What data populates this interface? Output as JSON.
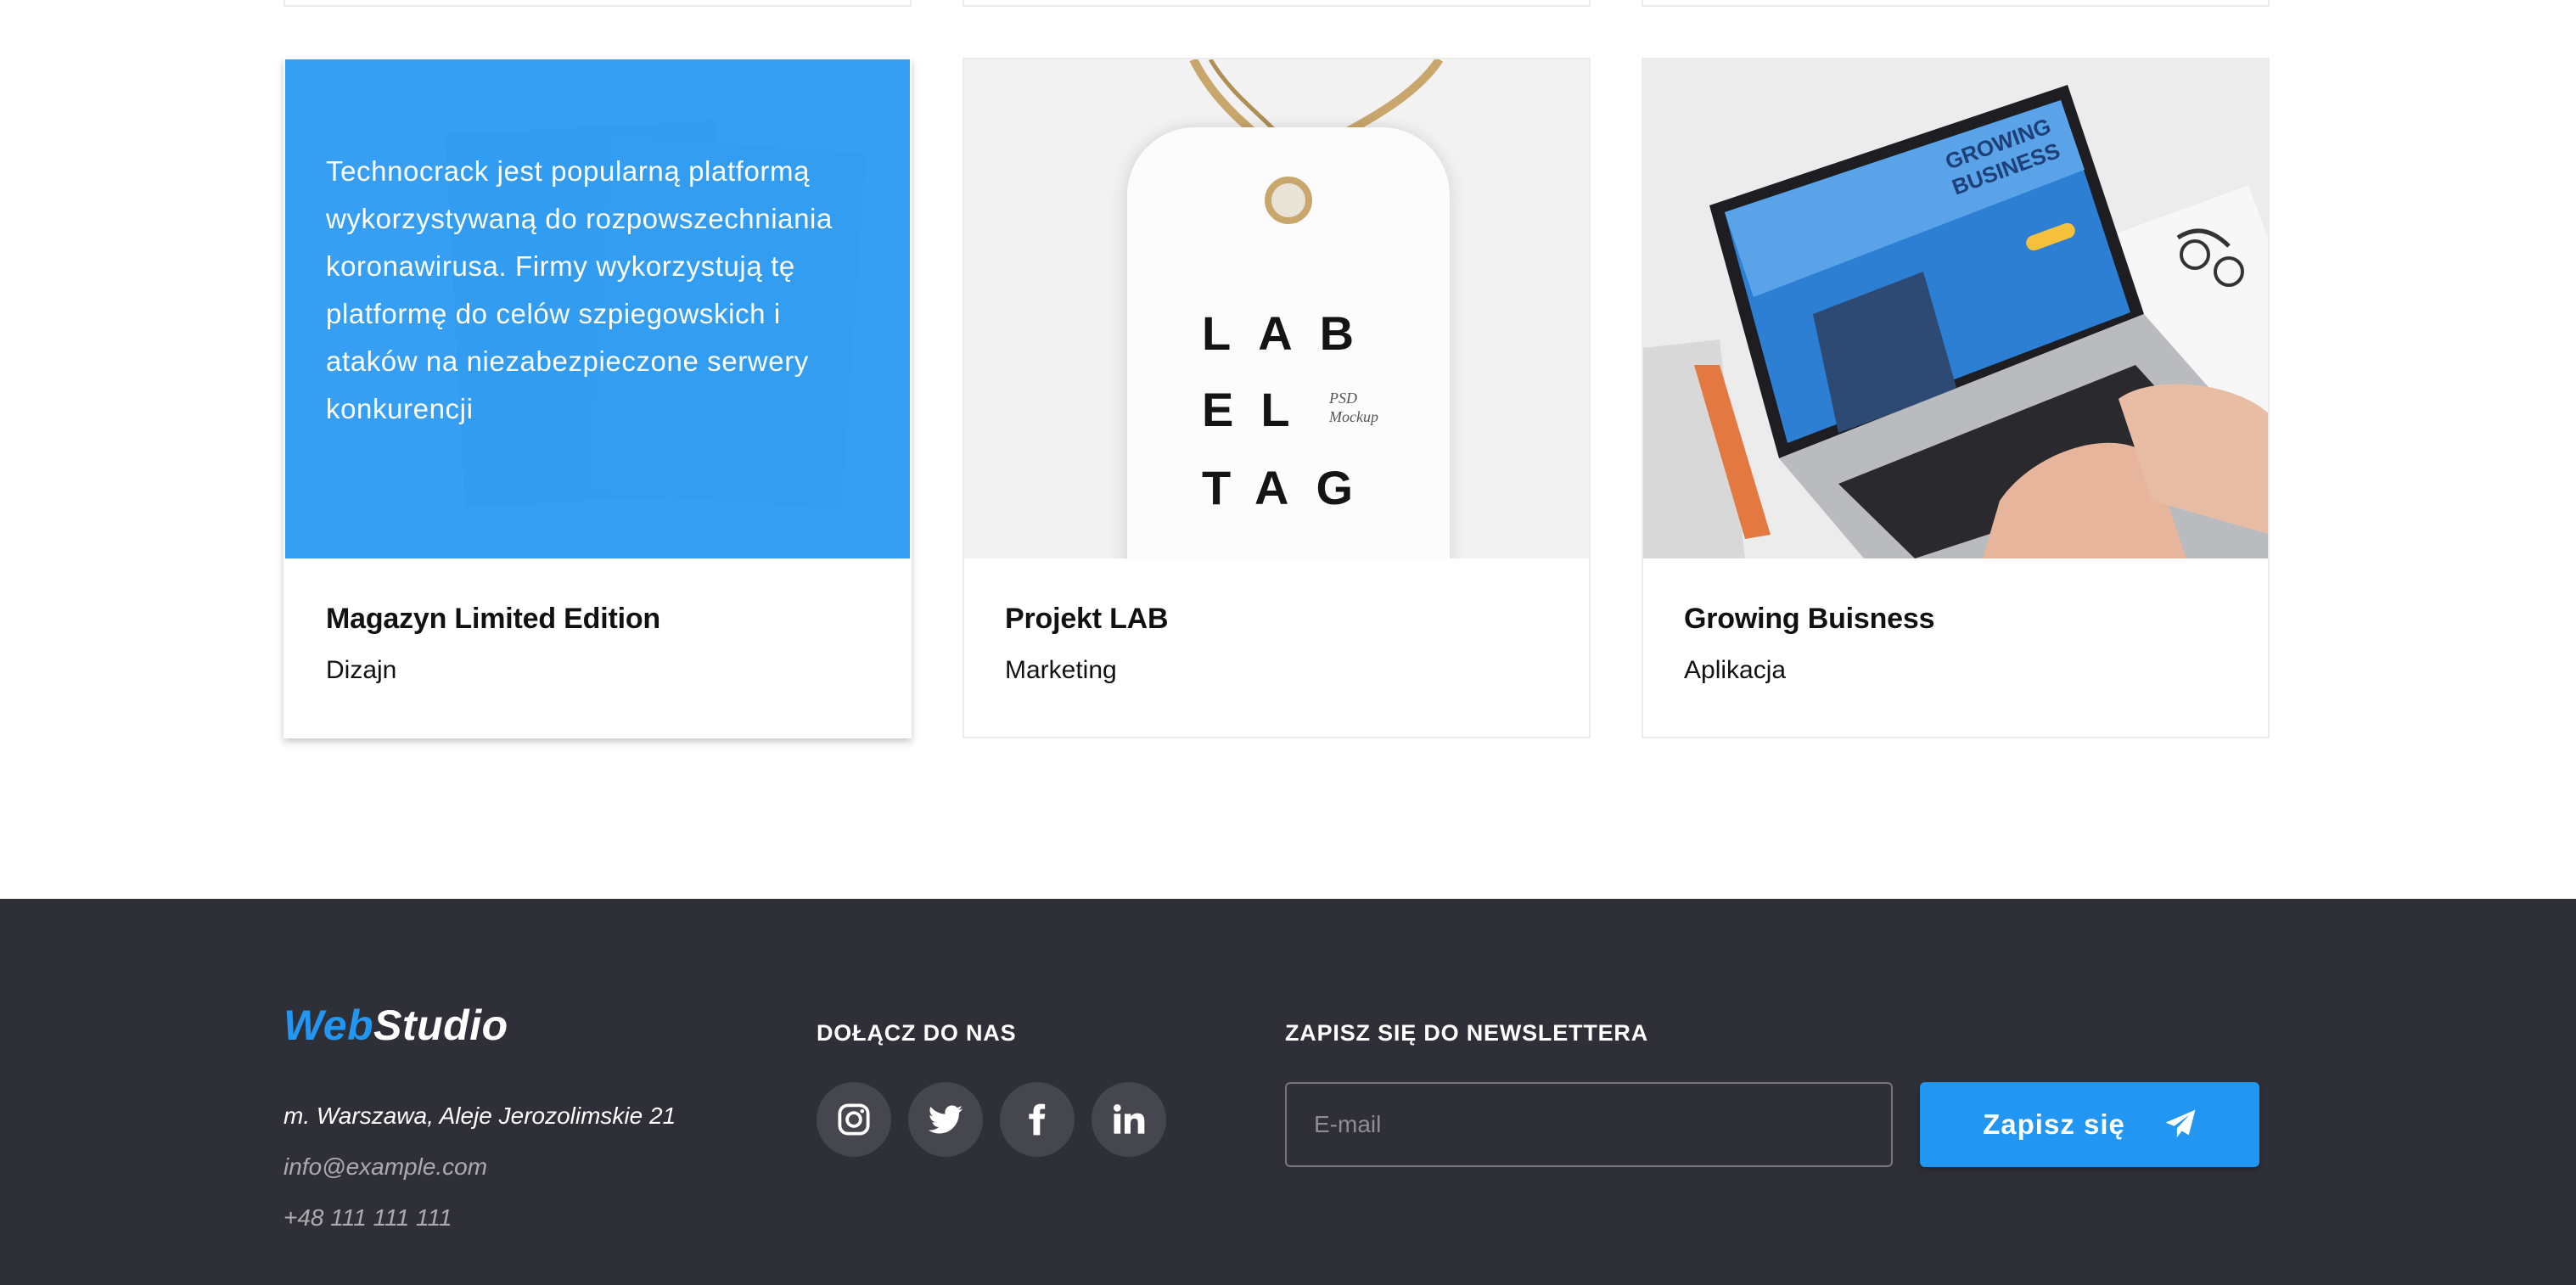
{
  "portfolio": {
    "cards": [
      {
        "title": "Magazyn Limited Edition",
        "category": "Dizajn",
        "overlay_text": "Technocrack jest popularną platformą wykorzystywaną do rozpowszechniania koronawirusa. Firmy wykorzystują tę platformę do celów szpiegowskich i ataków na niezabezpieczone serwery konkurencji",
        "image_icon": "magazine-image"
      },
      {
        "title": "Projekt LAB",
        "category": "Marketing",
        "image_icon": "label-tag-image",
        "tag_lines": [
          "LAB",
          "EL",
          "TAG"
        ],
        "tag_side": "PSD\nMockup"
      },
      {
        "title": "Growing Buisness",
        "category": "Aplikacja",
        "image_icon": "laptop-image",
        "screen_text": "GROWING\nBUSINESS"
      }
    ]
  },
  "footer": {
    "logo": {
      "part1": "Web",
      "part2": "Studio"
    },
    "address": "m. Warszawa, Aleje Jerozolimskie 21",
    "email": "info@example.com",
    "phone": "+48 111 111 111",
    "social_heading": "DOŁĄCZ DO NAS",
    "socials": [
      "instagram-icon",
      "twitter-icon",
      "facebook-icon",
      "linkedin-icon"
    ],
    "newsletter_heading": "ZAPISZ SIĘ DO NEWSLETTERA",
    "email_placeholder": "E-mail",
    "subscribe_label": "Zapisz się"
  },
  "colors": {
    "accent": "#2196f3",
    "footer_bg": "#2f2f37",
    "social_bg": "#46464f"
  }
}
